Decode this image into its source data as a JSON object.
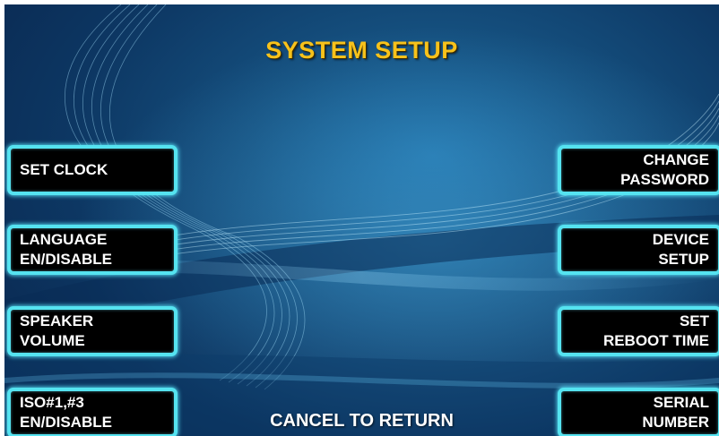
{
  "header": {
    "title": "SYSTEM SETUP"
  },
  "left_buttons": [
    {
      "line1": "SET CLOCK",
      "line2": ""
    },
    {
      "line1": "LANGUAGE",
      "line2": "EN/DISABLE"
    },
    {
      "line1": "SPEAKER",
      "line2": "VOLUME"
    },
    {
      "line1": "ISO#1,#3",
      "line2": "EN/DISABLE"
    }
  ],
  "right_buttons": [
    {
      "line1": "CHANGE",
      "line2": "PASSWORD"
    },
    {
      "line1": "DEVICE",
      "line2": "SETUP"
    },
    {
      "line1": "SET",
      "line2": "REBOOT TIME"
    },
    {
      "line1": "SERIAL",
      "line2": "NUMBER"
    }
  ],
  "footer": {
    "text": "CANCEL TO RETURN"
  },
  "colors": {
    "title": "#f7c21b",
    "button_border": "#55e3f0",
    "button_fill": "#000000",
    "background": "#0d3763"
  }
}
